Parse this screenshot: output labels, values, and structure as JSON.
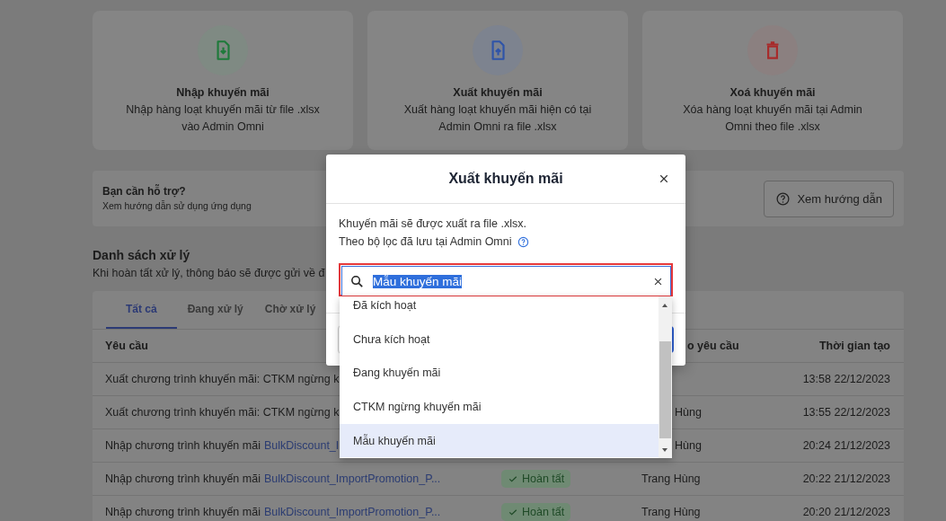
{
  "cards": [
    {
      "kind": "import",
      "title": "Nhập khuyến mãi",
      "description_lines": [
        "Nhập hàng loạt khuyến mãi từ file .xlsx",
        "vào Admin Omni"
      ]
    },
    {
      "kind": "export",
      "title": "Xuất khuyến mãi",
      "description_lines": [
        "Xuất hàng loạt khuyến mãi hiện có tại",
        "Admin Omni ra file .xlsx"
      ]
    },
    {
      "kind": "delete",
      "title": "Xoá khuyến mãi",
      "description_lines": [
        "Xóa hàng loạt khuyến mãi tại Admin",
        "Omni theo file .xlsx"
      ]
    }
  ],
  "help": {
    "title": "Bạn cần hỗ trợ?",
    "subtitle": "Xem hướng dẫn sử dụng ứng dụng",
    "button": "Xem hướng dẫn"
  },
  "section": {
    "title": "Danh sách xử lý",
    "subtitle": "Khi hoàn tất xử lý, thông báo sẽ được gửi về đ"
  },
  "tabs": [
    {
      "label": "Tất cả",
      "selected": true
    },
    {
      "label": "Đang xử lý",
      "selected": false
    },
    {
      "label": "Chờ xử lý",
      "selected": false
    }
  ],
  "table": {
    "columns": [
      {
        "label": "Yêu cầu"
      },
      {
        "label": "o yêu cầu",
        "covered_left": true
      },
      {
        "label": "Thời gian tạo"
      }
    ],
    "rows": [
      {
        "request": "Xuất chương trình khuyến mãi: CTKM ngừng k",
        "time": "13:58 22/12/2023"
      },
      {
        "request": "Xuất chương trình khuyến mãi: CTKM ngừng k",
        "requester": {
          "text": "Hùng",
          "covered_left": true
        },
        "time": "13:55 22/12/2023"
      },
      {
        "request": "Nhập chương trình khuyến mãi",
        "link": "BulkDiscount_I",
        "requester": {
          "text": "Hùng",
          "covered_left": true
        },
        "time": "20:24 21/12/2023"
      },
      {
        "request": "Nhập chương trình khuyến mãi",
        "link": "BulkDiscount_ImportPromotion_P...",
        "status": "Hoàn tất",
        "requester": {
          "text": "Trang Hùng"
        },
        "time": "20:22 21/12/2023"
      },
      {
        "request": "Nhập chương trình khuyến mãi",
        "link": "BulkDiscount_ImportPromotion_P...",
        "status": "Hoàn tất",
        "requester": {
          "text": "Trang Hùng"
        },
        "time": "20:20 21/12/2023"
      }
    ]
  },
  "modal": {
    "title": "Xuất khuyến mãi",
    "body_lines": [
      "Khuyến mãi sẽ được xuất ra file .xlsx.",
      "Theo bộ lọc đã lưu tại Admin Omni"
    ],
    "search": {
      "value": "Mẫu khuyến mãi",
      "value_selected": true,
      "highlighted": true
    },
    "options": [
      {
        "label": "Đã kích hoạt",
        "selected": false
      },
      {
        "label": "Chưa kích hoạt",
        "selected": false
      },
      {
        "label": "Đang khuyến mãi",
        "selected": false
      },
      {
        "label": "CTKM ngừng khuyến mãi",
        "selected": false
      },
      {
        "label": "Mẫu khuyến mãi",
        "selected": true
      }
    ]
  }
}
